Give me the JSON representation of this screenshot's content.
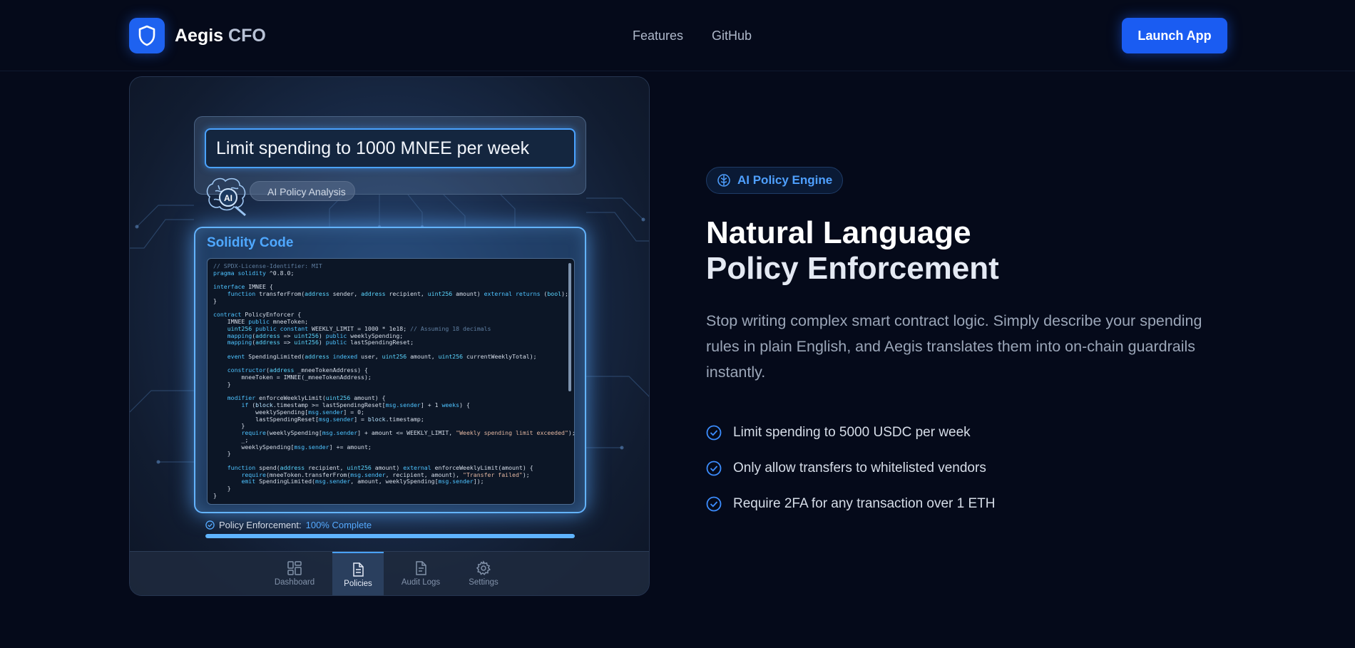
{
  "header": {
    "brand_main": "Aegis",
    "brand_sub": "CFO",
    "nav": [
      "Features",
      "GitHub"
    ],
    "launch_label": "Launch App"
  },
  "demo": {
    "prompt_value": "Limit spending to 1000 MNEE per week",
    "ai_chip_label": "AI Policy Analysis",
    "brain_text": "AI",
    "code_title": "Solidity Code",
    "status_label": "Policy Enforcement:",
    "status_value": "100% Complete",
    "progress": 1.0,
    "tabs": [
      {
        "label": "Dashboard",
        "icon": "dashboard-icon",
        "active": false
      },
      {
        "label": "Policies",
        "icon": "document-icon",
        "active": true
      },
      {
        "label": "Audit Logs",
        "icon": "file-text-icon",
        "active": false
      },
      {
        "label": "Settings",
        "icon": "gear-icon",
        "active": false
      }
    ]
  },
  "hero": {
    "badge": "AI Policy Engine",
    "headline_1": "Natural Language",
    "headline_2": "Policy Enforcement",
    "description": "Stop writing complex smart contract logic. Simply describe your spending rules in plain English, and Aegis translates them into on-chain guardrails instantly.",
    "features": [
      "Limit spending to 5000 USDC per week",
      "Only allow transfers to whitelisted vendors",
      "Require 2FA for any transaction over 1 ETH"
    ]
  },
  "colors": {
    "background": "#050a1a",
    "accent": "#1a5cf2",
    "highlight": "#4fa8ff"
  }
}
